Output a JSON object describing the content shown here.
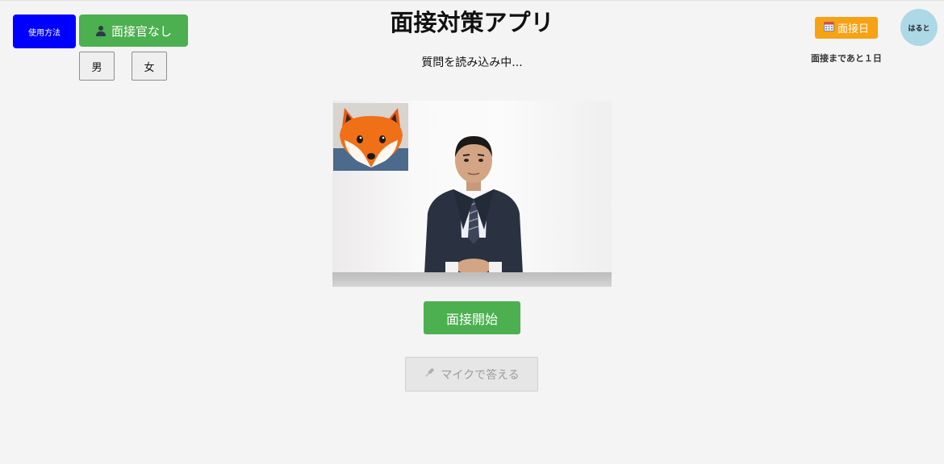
{
  "header": {
    "title": "面接対策アプリ",
    "status": "質問を読み込み中...",
    "howto_label": "使用方法",
    "interviewer_label": "面接官なし",
    "interviewer_icon": "person-icon",
    "gender_male_label": "男",
    "gender_female_label": "女"
  },
  "schedule": {
    "date_button_label": "面接日",
    "date_icon": "calendar-icon",
    "countdown_text": "面接まであと１日"
  },
  "user": {
    "name": "はると"
  },
  "controls": {
    "start_label": "面接開始",
    "mic_label": "マイクで答える",
    "mic_icon": "microphone-icon",
    "mic_disabled": true
  },
  "colors": {
    "howto_button": "#0000ff",
    "primary_green": "#4caf50",
    "date_button": "#f6a212",
    "avatar_bg": "#add8e6",
    "disabled_bg": "#e6e6e6"
  }
}
